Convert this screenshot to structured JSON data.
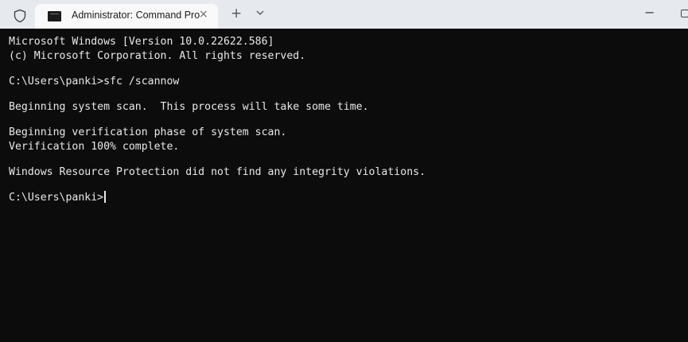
{
  "titlebar": {
    "tab_title": "Administrator: Command Pro",
    "tab_close_glyph": "×",
    "new_tab_glyph": "+",
    "minimize_glyph": "−",
    "icons": [
      "shield-icon",
      "cmd-app-icon",
      "close-icon",
      "plus-icon",
      "chevron-down-icon",
      "minimize-icon",
      "maximize-icon"
    ]
  },
  "console": {
    "lines": [
      "Microsoft Windows [Version 10.0.22622.586]",
      "(c) Microsoft Corporation. All rights reserved.",
      "",
      "C:\\Users\\panki>sfc /scannow",
      "",
      "Beginning system scan.  This process will take some time.",
      "",
      "Beginning verification phase of system scan.",
      "Verification 100% complete.",
      "",
      "Windows Resource Protection did not find any integrity violations.",
      "",
      "C:\\Users\\panki>"
    ]
  },
  "colors": {
    "console_background": "#0c0c0c",
    "console_text": "#e9e9e9",
    "titlebar_background": "#e6eaee",
    "active_tab_background": "#f9f9fa"
  }
}
